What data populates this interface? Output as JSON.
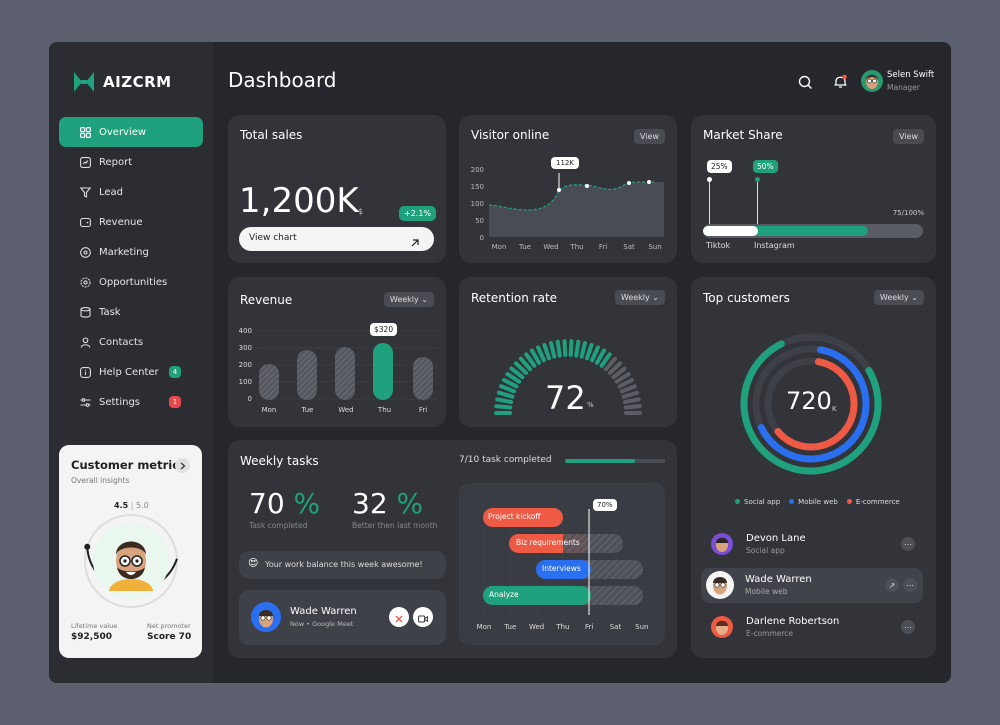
{
  "brand": {
    "name": "AIZCRM",
    "accent": "#1fa17d"
  },
  "header": {
    "title": "Dashboard",
    "user_name": "Selen Swift",
    "user_role": "Manager"
  },
  "sidebar": {
    "items": [
      {
        "label": "Overview",
        "icon": "grid-icon"
      },
      {
        "label": "Report",
        "icon": "report-icon"
      },
      {
        "label": "Lead",
        "icon": "funnel-icon"
      },
      {
        "label": "Revenue",
        "icon": "wallet-icon"
      },
      {
        "label": "Marketing",
        "icon": "megaphone-icon"
      },
      {
        "label": "Opportunities",
        "icon": "gear-icon"
      },
      {
        "label": "Task",
        "icon": "database-icon"
      },
      {
        "label": "Contacts",
        "icon": "user-icon"
      },
      {
        "label": "Help Center",
        "icon": "info-icon",
        "badge": "4"
      },
      {
        "label": "Settings",
        "icon": "sliders-icon",
        "badge": "1"
      }
    ]
  },
  "customer_metric": {
    "title": "Customer metric",
    "subtitle": "Overall insights",
    "rating": "4.5",
    "rating_max": "5.0",
    "lifetime_label": "Lifetime value",
    "lifetime_value": "$92,500",
    "promoter_label": "Net promoter",
    "promoter_value": "Score 70",
    "rating_fraction": 0.9
  },
  "total_sales": {
    "title": "Total sales",
    "value": "1,200K",
    "currency": "$",
    "change": "+2.1%",
    "button": "View chart"
  },
  "visitor": {
    "title": "Visitor online",
    "view": "View",
    "tooltip": "112K",
    "y_ticks": [
      "200",
      "150",
      "100",
      "50",
      "0"
    ],
    "days": [
      "Mon",
      "Tue",
      "Wed",
      "Thu",
      "Fri",
      "Sat",
      "Sun"
    ]
  },
  "market": {
    "title": "Market Share",
    "view": "View",
    "tiktok_pct": "25%",
    "instagram_pct": "50%",
    "total": "75/100%",
    "tiktok_label": "Tiktok",
    "instagram_label": "Instagram",
    "tiktok_share": 0.25,
    "instagram_share": 0.5
  },
  "revenue": {
    "title": "Revenue",
    "period": "Weekly",
    "tooltip": "$320",
    "y_ticks": [
      "400",
      "300",
      "200",
      "100",
      "0"
    ],
    "days": [
      "Mon",
      "Tue",
      "Wed",
      "Thu",
      "Fri"
    ]
  },
  "retention": {
    "title": "Retention rate",
    "period": "Weekly",
    "value": "72",
    "unit": "%",
    "fraction": 0.72
  },
  "top_customers": {
    "title": "Top customers",
    "period": "Weekly",
    "center_value": "720",
    "center_unit": "K",
    "legend": [
      {
        "label": "Social app",
        "color": "#1fa17d"
      },
      {
        "label": "Mobile web",
        "color": "#2a6ff0"
      },
      {
        "label": "E-commerce",
        "color": "#ef5a45"
      }
    ],
    "people": [
      {
        "name": "Devon Lane",
        "source": "Social app"
      },
      {
        "name": "Wade Warren",
        "source": "Mobile web"
      },
      {
        "name": "Darlene Robertson",
        "source": "E-commerce"
      }
    ]
  },
  "weekly_tasks": {
    "title": "Weekly tasks",
    "completed_text": "7/10 task completed",
    "completed_fraction": 0.7,
    "stat1_value": "70",
    "stat1_unit": "%",
    "stat1_label": "Task completed",
    "stat2_value": "32",
    "stat2_unit": "%",
    "stat2_label": "Better then last month",
    "message": "Your work balance this week awesome!",
    "meeting_name": "Wade Warren",
    "meeting_sub": "Now • Google Meet",
    "gantt_tooltip": "70%",
    "bars": [
      {
        "label": "Project kickoff",
        "color": "#ef5a45"
      },
      {
        "label": "Biz requirements",
        "color": "#ef5a45"
      },
      {
        "label": "Interviews",
        "color": "#2a6ff0"
      },
      {
        "label": "Analyze",
        "color": "#1fa17d"
      }
    ],
    "days": [
      "Mon",
      "Tue",
      "Wed",
      "Thu",
      "Fri",
      "Sat",
      "Sun"
    ]
  }
}
